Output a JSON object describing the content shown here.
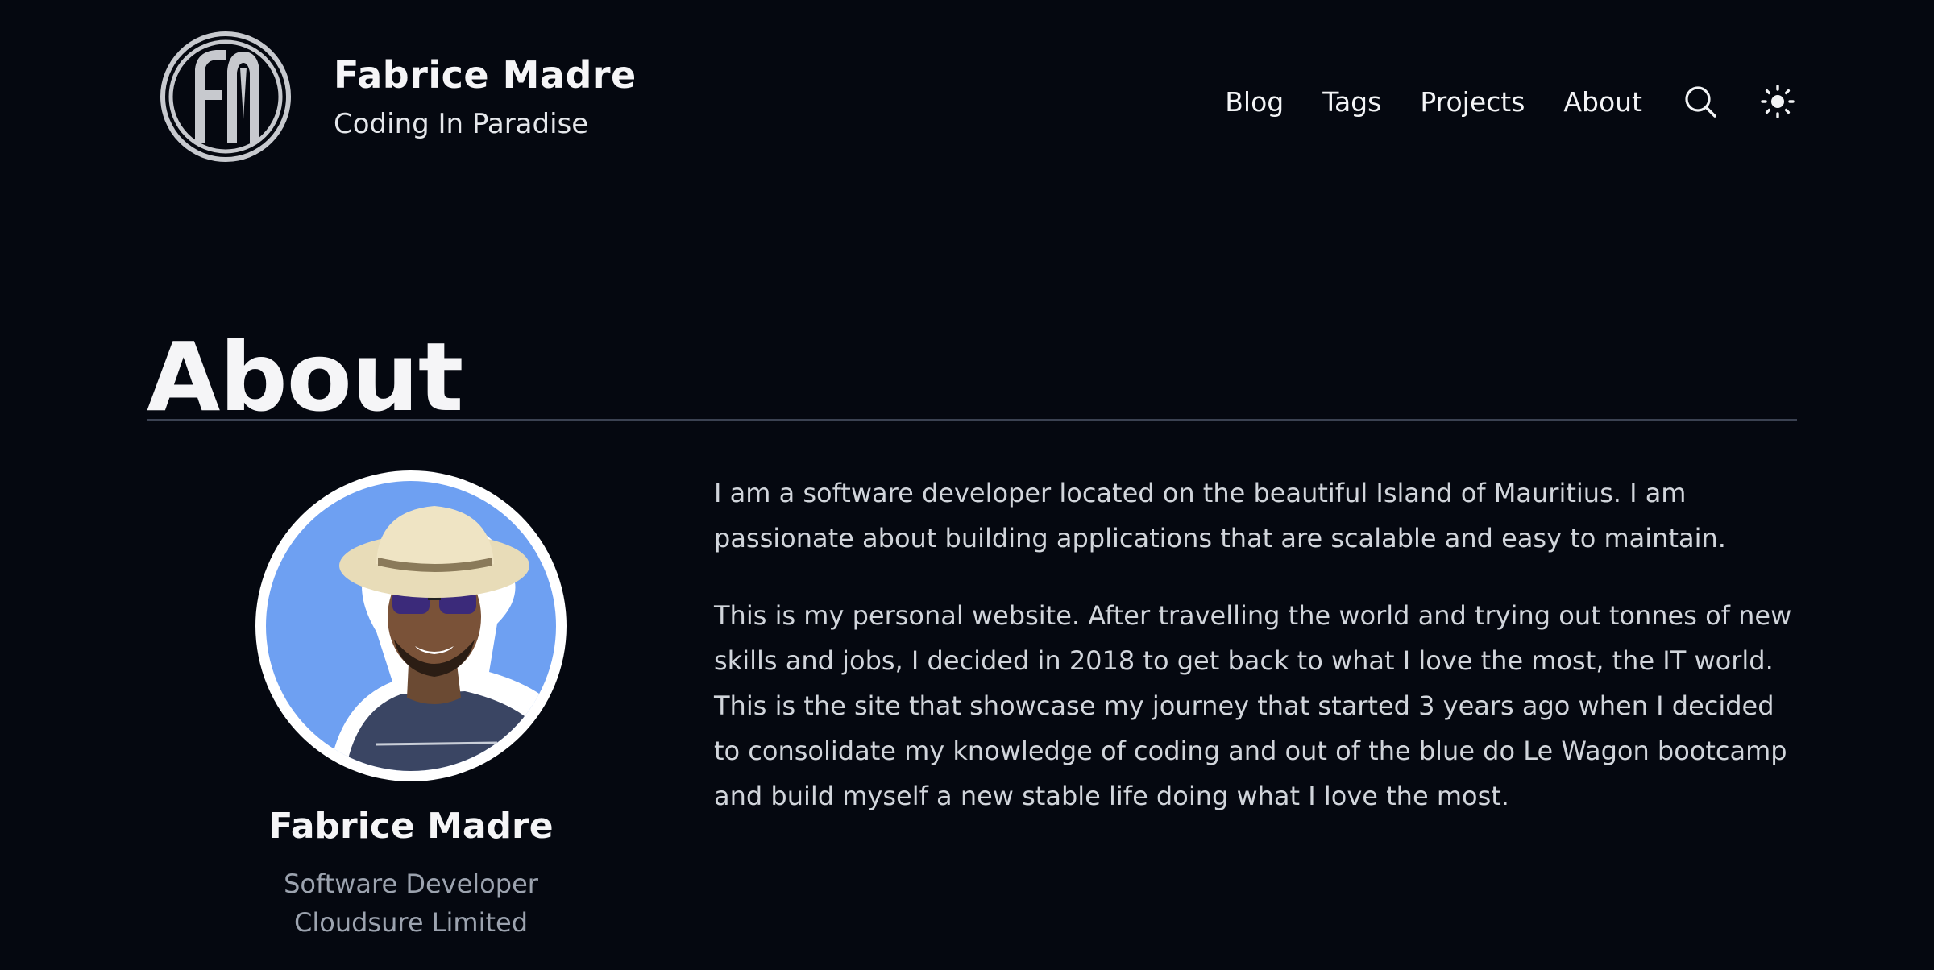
{
  "header": {
    "site_title": "Fabrice Madre",
    "site_subtitle": "Coding In Paradise",
    "logo_icon": "fm-monogram-logo",
    "nav": [
      {
        "label": "Blog"
      },
      {
        "label": "Tags"
      },
      {
        "label": "Projects"
      },
      {
        "label": "About"
      }
    ],
    "search_icon": "search-icon",
    "theme_icon": "sun-icon"
  },
  "page": {
    "title": "About"
  },
  "profile": {
    "name": "Fabrice Madre",
    "role": "Software Developer",
    "company": "Cloudsure Limited"
  },
  "bio": {
    "paragraphs": [
      "I am a software developer located on the beautiful Island of Mauritius. I am passionate about building applications that are scalable and easy to maintain.",
      "This is my personal website. After travelling the world and trying out tonnes of new skills and jobs, I decided in 2018 to get back to what I love the most, the IT world. This is the site that showcase my journey that started 3 years ago when I decided to consolidate my knowledge of coding and out of the blue do Le Wagon bootcamp and build myself a new stable life doing what I love the most."
    ]
  },
  "colors": {
    "background": "#050810",
    "text": "#f3f4f6",
    "muted": "#9ca3af",
    "divider": "#3b4252",
    "avatar_bg": "#6ea0f2"
  }
}
